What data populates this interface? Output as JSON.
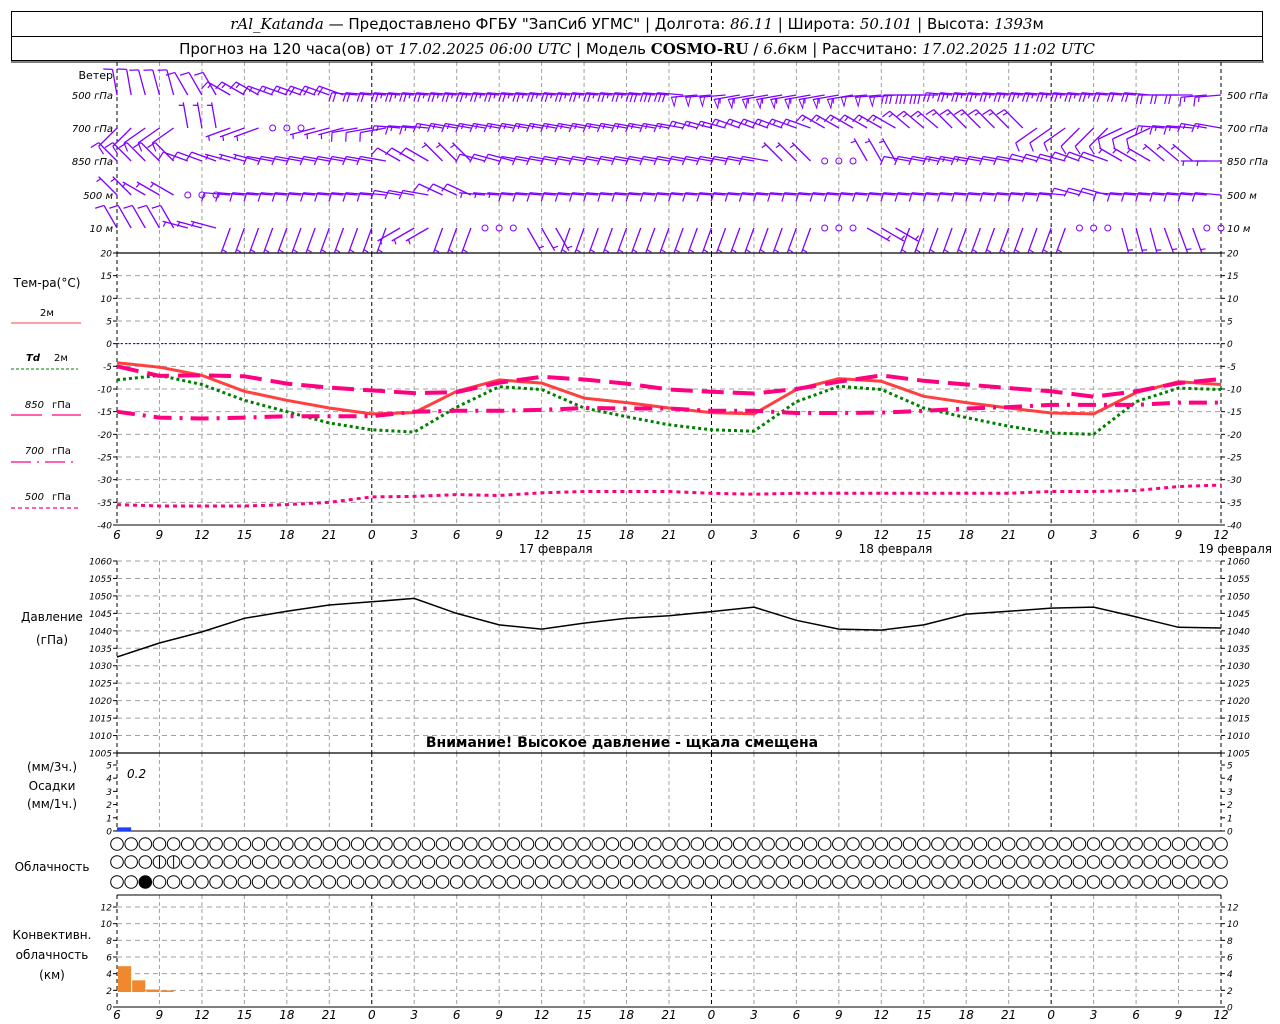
{
  "header": {
    "station": "rAl_Katanda",
    "provided": " — Предоставлено ФГБУ \"ЗапСиб УГМС\" | Долгота: ",
    "lon": "86.11",
    "lat_label": " | Широта: ",
    "lat": "50.101",
    "alt_label": " | Высота: ",
    "alt": "1393",
    "alt_unit": "м",
    "forecast_label": "Прогноз на 120 часа(ов) от ",
    "forecast_time": "17.02.2025 06:00 UTC",
    "model_label": "  | Модель ",
    "model": "COSMO-RU",
    "slash": " / ",
    "res": "6.6",
    "res_unit": "км",
    "calc_label": " | Рассчитано: ",
    "calc_time": "17.02.2025 11:02 UTC"
  },
  "colors": {
    "wind": "#8000ff",
    "t2m": "#ff4040",
    "td": "#008000",
    "upper": "#ff0080",
    "zero": "#0000ff",
    "precip": "#2040ff",
    "conv": "#f08830",
    "grid": "#a0a0a0"
  },
  "labels": {
    "wind": "Ветер",
    "wind_levels": [
      "500 гПа",
      "700 гПа",
      "850 гПа",
      "500 м",
      "10   м"
    ],
    "temp_title": "Тем-ра(°С)",
    "t2m": "2м",
    "td_a": "Td",
    "td_b": "2м",
    "t850_a": "850",
    "t850_b": "гПа",
    "t700_a": "700",
    "t700_b": "гПа",
    "t500_a": "500",
    "t500_b": "гПа",
    "pressure_a": "Давление",
    "pressure_b": "(гПа)",
    "precip_a": "(мм/3ч.)",
    "precip_b": "Осадки",
    "precip_c": "(мм/1ч.)",
    "cloud": "Облачность",
    "conv_a": "Конвективн.",
    "conv_b": "облачность",
    "conv_c": "(км)",
    "warning": "Внимание! Высокое давление - щкала смещена",
    "precip_value": "0.2"
  },
  "chart_data": {
    "type": "line",
    "hour_labels": [
      "6",
      "9",
      "12",
      "15",
      "18",
      "21",
      "0",
      "3",
      "6",
      "9",
      "12",
      "15",
      "18",
      "21",
      "0",
      "3",
      "6",
      "9",
      "12",
      "15",
      "18",
      "21",
      "0",
      "3",
      "6",
      "9",
      "12"
    ],
    "date_labels": [
      "17 февраля",
      "18 февраля",
      "19 февраля"
    ],
    "wind": {
      "levels": [
        {
          "name": "500 гПа",
          "dir": [
            350,
            345,
            330,
            300,
            290,
            290,
            275,
            275,
            275,
            275,
            275,
            275,
            275,
            275,
            265,
            260,
            260,
            260,
            265,
            270,
            275,
            275,
            275,
            275,
            275,
            270,
            265
          ],
          "speed": [
            10,
            10,
            10,
            15,
            15,
            20,
            20,
            25,
            25,
            25,
            25,
            25,
            25,
            30,
            50,
            55,
            55,
            55,
            50,
            30,
            25,
            25,
            25,
            25,
            20,
            20,
            15
          ]
        },
        {
          "name": "700 гПа",
          "dir": [
            225,
            235,
            350,
            250,
            250,
            255,
            260,
            275,
            280,
            280,
            280,
            280,
            280,
            280,
            285,
            290,
            290,
            300,
            300,
            310,
            315,
            315,
            235,
            225,
            245,
            275,
            280
          ],
          "speed": [
            10,
            10,
            5,
            5,
            0,
            5,
            10,
            15,
            15,
            15,
            15,
            15,
            15,
            15,
            15,
            15,
            15,
            15,
            15,
            15,
            15,
            15,
            10,
            10,
            10,
            15,
            15
          ]
        },
        {
          "name": "850 гПа",
          "dir": [
            315,
            315,
            290,
            285,
            280,
            280,
            280,
            300,
            315,
            285,
            280,
            280,
            280,
            280,
            280,
            280,
            315,
            0,
            330,
            280,
            280,
            280,
            285,
            290,
            300,
            310,
            270
          ],
          "speed": [
            10,
            10,
            10,
            5,
            10,
            10,
            10,
            10,
            5,
            10,
            10,
            10,
            10,
            10,
            10,
            10,
            5,
            0,
            5,
            10,
            15,
            10,
            10,
            10,
            5,
            5,
            5
          ]
        },
        {
          "name": "500 м",
          "dir": [
            315,
            300,
            270,
            275,
            275,
            275,
            275,
            280,
            295,
            275,
            275,
            275,
            275,
            275,
            275,
            275,
            275,
            275,
            275,
            275,
            275,
            275,
            275,
            285,
            275,
            275,
            275
          ],
          "speed": [
            5,
            5,
            0,
            10,
            10,
            10,
            10,
            10,
            10,
            5,
            10,
            10,
            10,
            10,
            10,
            10,
            10,
            10,
            10,
            10,
            10,
            10,
            10,
            10,
            10,
            10,
            10
          ]
        },
        {
          "name": "10 м",
          "dir": [
            330,
            330,
            285,
            200,
            200,
            200,
            200,
            240,
            200,
            200,
            150,
            200,
            200,
            200,
            200,
            200,
            200,
            200,
            120,
            200,
            200,
            200,
            200,
            200,
            165,
            160,
            0
          ],
          "speed": [
            10,
            10,
            5,
            5,
            5,
            5,
            5,
            5,
            5,
            0,
            5,
            5,
            5,
            5,
            5,
            5,
            5,
            0,
            5,
            5,
            5,
            5,
            5,
            0,
            5,
            5,
            0
          ]
        }
      ]
    },
    "temperature": {
      "ylim": [
        -40,
        20
      ],
      "ticks": [
        20,
        15,
        10,
        5,
        0,
        -5,
        -10,
        -15,
        -20,
        -25,
        -30,
        -35,
        -40
      ],
      "series": [
        {
          "name": "2м",
          "values": [
            -4.2,
            -5.2,
            -7,
            -10.5,
            -12.5,
            -14.2,
            -15.5,
            -15.2,
            -10.5,
            -8,
            -8.7,
            -12,
            -13,
            -14.2,
            -15.2,
            -15.5,
            -10.1,
            -7.7,
            -8.3,
            -11.6,
            -13,
            -14.2,
            -15.3,
            -15.5,
            -10.8,
            -8.4,
            -9
          ]
        },
        {
          "name": "Td 2м",
          "values": [
            -8,
            -7,
            -9,
            -12.5,
            -15,
            -17.5,
            -19,
            -19.5,
            -14,
            -9.5,
            -10.1,
            -14.2,
            -16.1,
            -17.9,
            -19,
            -19.3,
            -12.8,
            -9.4,
            -10.1,
            -14.2,
            -16.3,
            -18.2,
            -19.7,
            -20,
            -12.8,
            -9.8,
            -10.1
          ]
        },
        {
          "name": "850 гПа",
          "values": [
            -5,
            -7.1,
            -7,
            -7.2,
            -8.8,
            -9.7,
            -10.3,
            -10.9,
            -10.7,
            -8.6,
            -7.3,
            -7.9,
            -8.8,
            -10.1,
            -10.6,
            -11,
            -10,
            -8.4,
            -7,
            -8.2,
            -9,
            -9.8,
            -10.5,
            -11.7,
            -10.5,
            -8.7,
            -7.8
          ]
        },
        {
          "name": "700 гПа",
          "values": [
            -15,
            -16.3,
            -16.5,
            -16.3,
            -16,
            -16,
            -16,
            -15,
            -14.8,
            -14.8,
            -14.6,
            -14.2,
            -14.3,
            -14.3,
            -14.8,
            -14.8,
            -15.3,
            -15.3,
            -15.2,
            -14.8,
            -14.3,
            -14,
            -13.5,
            -13.5,
            -13.5,
            -13,
            -13
          ]
        },
        {
          "name": "500 гПа",
          "values": [
            -35.5,
            -35.8,
            -35.8,
            -35.8,
            -35.5,
            -35,
            -33.8,
            -33.7,
            -33.3,
            -33.5,
            -32.9,
            -32.6,
            -32.6,
            -32.6,
            -33,
            -33.2,
            -33,
            -33,
            -33,
            -33,
            -33,
            -33,
            -32.6,
            -32.6,
            -32.4,
            -31.5,
            -31.2
          ]
        }
      ]
    },
    "pressure": {
      "ylim": [
        1005,
        1060
      ],
      "ticks": [
        1060,
        1055,
        1050,
        1045,
        1040,
        1035,
        1030,
        1025,
        1020,
        1015,
        1010,
        1005
      ],
      "values": [
        1032.5,
        1036.5,
        1039.7,
        1043.6,
        1045.6,
        1047.4,
        1048.3,
        1049.3,
        1045,
        1041.7,
        1040.5,
        1042.2,
        1043.6,
        1044.3,
        1045.5,
        1046.8,
        1043,
        1040.5,
        1040.2,
        1041.7,
        1044.8,
        1045.6,
        1046.5,
        1046.8,
        1044,
        1041,
        1040.8
      ]
    },
    "precipitation": {
      "ylim": [
        0,
        5
      ],
      "ticks": [
        5,
        4,
        3,
        2,
        1,
        0
      ],
      "hourly": [
        {
          "hour": 0,
          "value": 0.2
        }
      ]
    },
    "cloud_cover": {
      "rows": 3,
      "hours": 79,
      "marks": [
        {
          "row": 1,
          "hour": 3,
          "value": "partial"
        },
        {
          "row": 1,
          "hour": 4,
          "value": "partial"
        },
        {
          "row": 2,
          "hour": 2,
          "value": "overcast"
        }
      ]
    },
    "convective_cloud": {
      "ylim": [
        0,
        13
      ],
      "ticks": [
        12,
        10,
        8,
        6,
        4,
        2,
        0
      ],
      "bars": [
        {
          "hour": 0,
          "base": 1.8,
          "top": 4.9
        },
        {
          "hour": 1,
          "base": 1.8,
          "top": 3.2
        },
        {
          "hour": 2,
          "base": 1.8,
          "top": 2.1
        },
        {
          "hour": 3,
          "base": 1.8,
          "top": 2.0
        }
      ]
    }
  }
}
